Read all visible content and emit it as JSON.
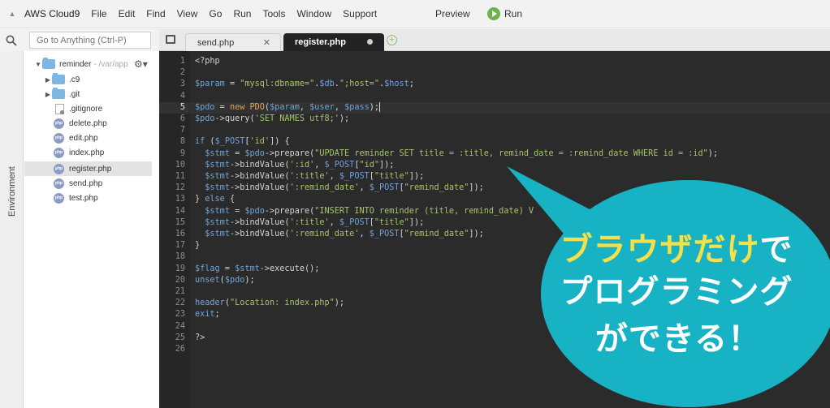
{
  "menubar": {
    "brand": "AWS Cloud9",
    "items": [
      "File",
      "Edit",
      "Find",
      "View",
      "Go",
      "Run",
      "Tools",
      "Window",
      "Support"
    ],
    "preview": "Preview",
    "run": "Run"
  },
  "search": {
    "placeholder": "Go to Anything (Ctrl-P)"
  },
  "rail": {
    "label": "Environment"
  },
  "tree": {
    "root": {
      "name": "reminder",
      "path": "- /var/app"
    },
    "items": [
      {
        "name": ".c9",
        "type": "folder"
      },
      {
        "name": ".git",
        "type": "folder"
      },
      {
        "name": ".gitignore",
        "type": "file"
      },
      {
        "name": "delete.php",
        "type": "php"
      },
      {
        "name": "edit.php",
        "type": "php"
      },
      {
        "name": "index.php",
        "type": "php"
      },
      {
        "name": "register.php",
        "type": "php",
        "selected": true
      },
      {
        "name": "send.php",
        "type": "php"
      },
      {
        "name": "test.php",
        "type": "php"
      }
    ]
  },
  "tabs": [
    {
      "label": "send.php",
      "active": false
    },
    {
      "label": "register.php",
      "active": true
    }
  ],
  "editor": {
    "current_line": 5,
    "lines": [
      "<?php",
      "",
      "$param = \"mysql:dbname=\".$db.\";host=\".$host;",
      "",
      "$pdo = new PDO($param, $user, $pass);",
      "$pdo->query('SET NAMES utf8;');",
      "",
      "if ($_POST['id']) {",
      "  $stmt = $pdo->prepare(\"UPDATE reminder SET title = :title, remind_date = :remind_date WHERE id = :id\");",
      "  $stmt->bindValue(':id', $_POST[\"id\"]);",
      "  $stmt->bindValue(':title', $_POST[\"title\"]);",
      "  $stmt->bindValue(':remind_date', $_POST[\"remind_date\"]);",
      "} else {",
      "  $stmt = $pdo->prepare(\"INSERT INTO reminder (title, remind_date) V",
      "  $stmt->bindValue(':title', $_POST[\"title\"]);",
      "  $stmt->bindValue(':remind_date', $_POST[\"remind_date\"]);",
      "}",
      "",
      "$flag = $stmt->execute();",
      "unset($pdo);",
      "",
      "header(\"Location: index.php\");",
      "exit;",
      "",
      "?>",
      ""
    ]
  },
  "callout": {
    "line1_highlight": "ブラウザだけ",
    "line1_rest": "で",
    "line2": "プログラミング",
    "line3": "ができる！",
    "color": "#17b3c4",
    "highlight_color": "#f5e04a"
  }
}
